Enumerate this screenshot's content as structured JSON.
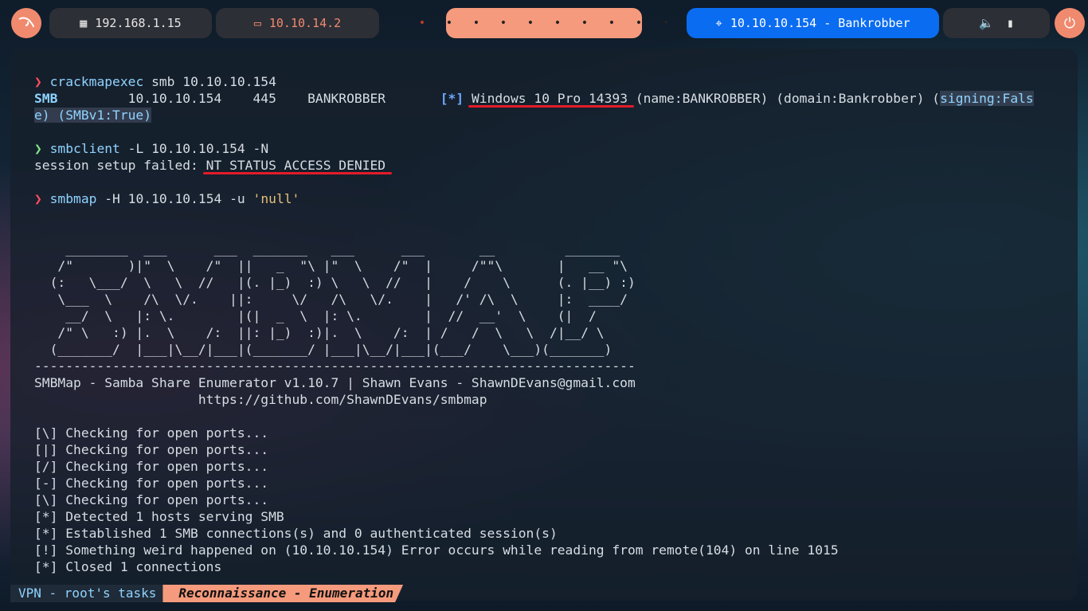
{
  "topbar": {
    "target_ip": "192.168.1.15",
    "vpn_ip": "10.10.14.2",
    "workspace_dots": [
      "•",
      "•",
      "•",
      "•",
      "•",
      "•",
      "•",
      "•",
      "•",
      "•"
    ],
    "target_box": "10.10.10.154 - Bankrobber",
    "battery_icon": "battery-icon",
    "volume_icon": "volume-icon",
    "power_icon": "power-icon",
    "accent": "#f08a6e",
    "blue": "#0a6cf0"
  },
  "terminal": {
    "prompt_symbol": "❯",
    "l1": {
      "cmd": "crackmapexec",
      "args": " smb 10.10.10.154"
    },
    "l2": {
      "smb": "SMB",
      "mid": "         10.10.10.154    445    BANKROBBER       ",
      "star": "[*]",
      "os": "Windows 10 Pro 14393",
      "rest": " (name:BANKROBBER) (domain:Bankrobber) (",
      "sign": "signing:Fals"
    },
    "l3": {
      "text": "e) (SMBv1:True)"
    },
    "l4": {
      "cmd": "smbclient",
      "flag": " -L",
      "args": " 10.10.10.154",
      "flag2": " -N"
    },
    "l5": {
      "pre": "session setup failed: ",
      "err": "NT_STATUS_ACCESS_DENIED"
    },
    "l6": {
      "cmd": "smbmap",
      "flag": " -H",
      "args": " 10.10.10.154",
      "flag2": " -u",
      "quote": " 'null'"
    },
    "ascii": [
      "    ________  ___      ___  _______   ___      ___       __         _______",
      "   /\"       )|\"  \\    /\"  ||   _  \"\\ |\"  \\    /\"  |     /\"\"\\       |   __ \"\\",
      "  (:   \\___/  \\   \\  //   |(. |_)  :) \\   \\  //   |    /    \\      (. |__) :)",
      "   \\___  \\    /\\  \\/.    ||:     \\/   /\\   \\/.    |   /' /\\  \\     |:  ____/",
      "    __/  \\   |: \\.        |(|  _  \\  |: \\.        |  //  __'  \\    (|  /",
      "   /\" \\   :) |.  \\    /:  ||: |_)  :)|.  \\    /:  | /   /  \\   \\  /|__/ \\",
      "  (_______/  |___|\\__/|___|(_______/ |___|\\__/|___|(___/    \\___)(_______)"
    ],
    "dashes": "-----------------------------------------------------------------------------",
    "banner1": "SMBMap - Samba Share Enumerator v1.10.7 | Shawn Evans - ShawnDEvans@gmail.com",
    "banner2": "                     https://github.com/ShawnDEvans/smbmap",
    "out": [
      "[\\] Checking for open ports...",
      "[|] Checking for open ports...",
      "[/] Checking for open ports...",
      "[-] Checking for open ports...",
      "[\\] Checking for open ports...",
      "[*] Detected 1 hosts serving SMB",
      "[*] Established 1 SMB connections(s) and 0 authenticated session(s)",
      "[!] Something weird happened on (10.10.10.154) Error occurs while reading from remote(104) on line 1015",
      "[*] Closed 1 connections"
    ]
  },
  "statusbar": {
    "session": "VPN - root's tasks",
    "window": "Reconnaissance - Enumeration"
  }
}
